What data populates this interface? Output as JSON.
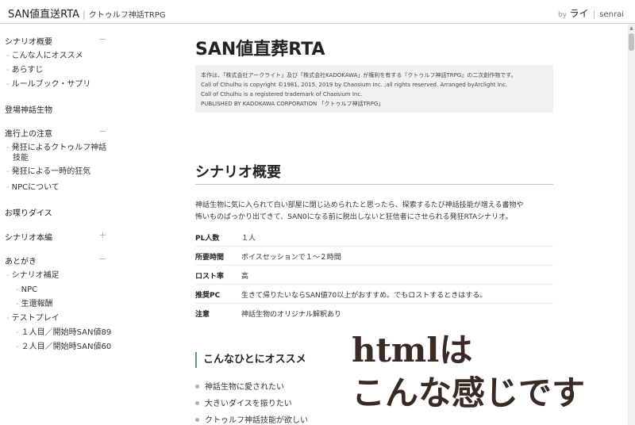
{
  "header": {
    "brand": "SAN値直送RTA",
    "brand_sub": "クトゥルフ神話TRPG",
    "by": "by",
    "author": "ライ",
    "site": "senrai"
  },
  "sidebar": {
    "sections": [
      {
        "label": "シナリオ概要",
        "toggle": "−"
      },
      {
        "label": "登場神話生物",
        "toggle": ""
      },
      {
        "label": "進行上の注意",
        "toggle": "−"
      },
      {
        "label": "お喋りダイス",
        "toggle": ""
      },
      {
        "label": "シナリオ本編",
        "toggle": "+"
      },
      {
        "label": "あとがき",
        "toggle": "−"
      }
    ],
    "items": [
      "こんな人にオススメ",
      "あらすじ",
      "ルールブック・サプリ",
      "発狂によるクトゥルフ神話",
      "技能",
      "発狂による一時的狂気",
      "NPCについて",
      "シナリオ補足",
      "NPC",
      "生還報酬",
      "テストプレイ",
      "１人目／開始時SAN値89",
      "２人目／開始時SAN値60"
    ]
  },
  "main": {
    "title": "SAN値直葬RTA",
    "notice": [
      "本作は、「株式会社アークライト」及び「株式会社KADOKAWA」が権利を有する『クトゥルフ神話TRPG』の二次創作物です。",
      "Call of Cthulhu is copyright ©1981, 2015, 2019 by Chaosium Inc. ;all rights reserved. Arranged byArclight Inc.",
      "Call of Cthulhu is a registered trademark of Chaosium Inc.",
      "PUBLISHED BY KADOKAWA CORPORATION 「クトゥルフ神話TRPG」"
    ],
    "section_title": "シナリオ概要",
    "intro": [
      "神話生物に気に入られて白い部屋に閉じ込められたと思ったら、探索するたび神話技能が増える書物や",
      "怖いものばっかり出てきて、SAN0になる前に脱出しないと狂信者にさせられる発狂RTAシナリオ。"
    ],
    "specs": [
      {
        "key": "PL人数",
        "value": "１人"
      },
      {
        "key": "所要時間",
        "value": "ボイスセッションで１～２時間"
      },
      {
        "key": "ロスト率",
        "value": "高"
      },
      {
        "key": "推奨PC",
        "value": "生きて帰りたいならSAN値70以上がおすすめ。でもロストするときはする。"
      },
      {
        "key": "注意",
        "value": "神話生物のオリジナル解釈あり"
      }
    ],
    "subsection_title": "こんなひとにオススメ",
    "bullets": [
      "神話生物に愛されたい",
      "大きいダイスを振りたい",
      "クトゥルフ神話技能が欲しい"
    ]
  },
  "overlay": {
    "line1": "htmlは",
    "line2": "こんな感じです"
  }
}
